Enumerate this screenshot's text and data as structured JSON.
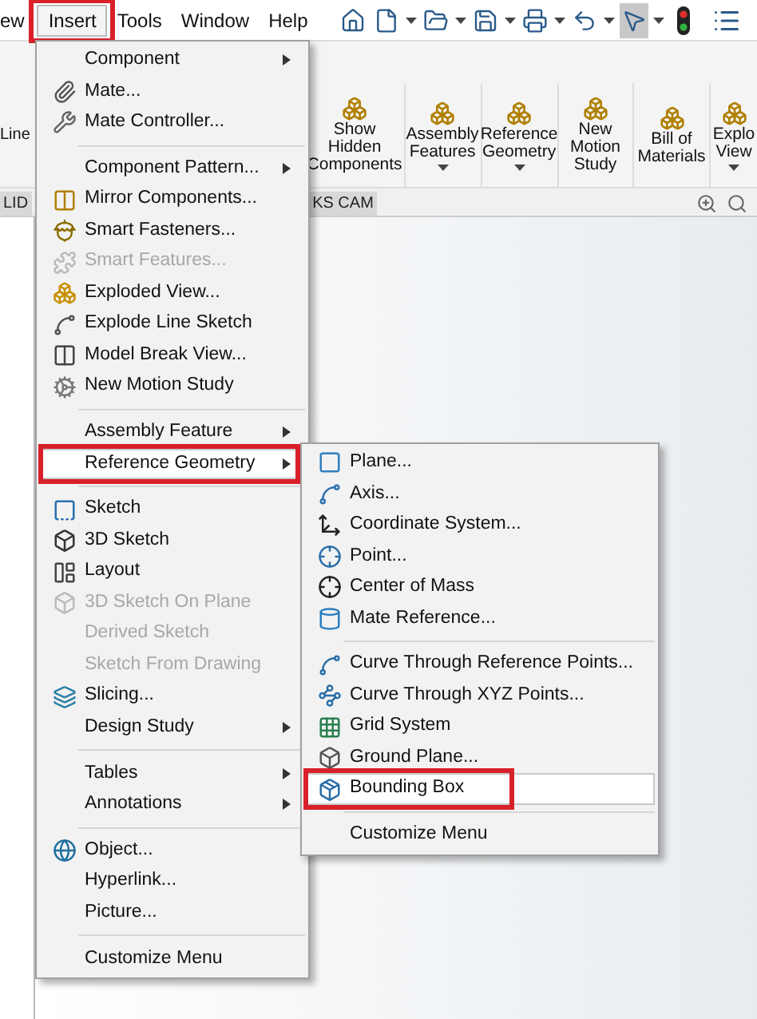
{
  "menubar": [
    {
      "label": "ew",
      "selected": false
    },
    {
      "label": "Insert",
      "selected": true
    },
    {
      "label": "Tools",
      "selected": false
    },
    {
      "label": "Window",
      "selected": false
    },
    {
      "label": "Help",
      "selected": false
    }
  ],
  "ribbon": {
    "cut_label": "Line",
    "buttons": [
      {
        "label": "Show\nHidden\nComponents",
        "dropdown": false
      },
      {
        "label": "Assembly\nFeatures",
        "dropdown": true
      },
      {
        "label": "Reference\nGeometry",
        "dropdown": true
      },
      {
        "label": "New\nMotion\nStudy",
        "dropdown": false
      },
      {
        "label": "Bill of\nMaterials",
        "dropdown": false
      },
      {
        "label": "Explo\nView",
        "dropdown": true
      }
    ]
  },
  "tabs": [
    {
      "label": "LID",
      "selected": false
    },
    {
      "label": "KS CAM",
      "selected": false
    }
  ],
  "insert_menu": [
    {
      "kind": "item",
      "label": "Component",
      "submenu": true,
      "disabled": false,
      "selected": false
    },
    {
      "kind": "item",
      "label": "Mate...",
      "submenu": false,
      "disabled": false,
      "selected": false
    },
    {
      "kind": "item",
      "label": "Mate Controller...",
      "submenu": false,
      "disabled": false,
      "selected": false
    },
    {
      "kind": "separator"
    },
    {
      "kind": "item",
      "label": "Component Pattern...",
      "submenu": true,
      "disabled": false,
      "selected": false
    },
    {
      "kind": "item",
      "label": "Mirror Components...",
      "submenu": false,
      "disabled": false,
      "selected": false
    },
    {
      "kind": "item",
      "label": "Smart Fasteners...",
      "submenu": false,
      "disabled": false,
      "selected": false
    },
    {
      "kind": "item",
      "label": "Smart Features...",
      "submenu": false,
      "disabled": true,
      "selected": false
    },
    {
      "kind": "item",
      "label": "Exploded View...",
      "submenu": false,
      "disabled": false,
      "selected": false
    },
    {
      "kind": "item",
      "label": "Explode Line Sketch",
      "submenu": false,
      "disabled": false,
      "selected": false
    },
    {
      "kind": "item",
      "label": "Model Break View...",
      "submenu": false,
      "disabled": false,
      "selected": false
    },
    {
      "kind": "item",
      "label": "New Motion Study",
      "submenu": false,
      "disabled": false,
      "selected": false
    },
    {
      "kind": "separator"
    },
    {
      "kind": "item",
      "label": "Assembly Feature",
      "submenu": true,
      "disabled": false,
      "selected": false
    },
    {
      "kind": "item",
      "label": "Reference Geometry",
      "submenu": true,
      "disabled": false,
      "selected": true
    },
    {
      "kind": "separator"
    },
    {
      "kind": "item",
      "label": "Sketch",
      "submenu": false,
      "disabled": false,
      "selected": false
    },
    {
      "kind": "item",
      "label": "3D Sketch",
      "submenu": false,
      "disabled": false,
      "selected": false
    },
    {
      "kind": "item",
      "label": "Layout",
      "submenu": false,
      "disabled": false,
      "selected": false
    },
    {
      "kind": "item",
      "label": "3D Sketch On Plane",
      "submenu": false,
      "disabled": true,
      "selected": false
    },
    {
      "kind": "item",
      "label": "Derived Sketch",
      "submenu": false,
      "disabled": true,
      "selected": false
    },
    {
      "kind": "item",
      "label": "Sketch From Drawing",
      "submenu": false,
      "disabled": true,
      "selected": false
    },
    {
      "kind": "item",
      "label": "Slicing...",
      "submenu": false,
      "disabled": false,
      "selected": false
    },
    {
      "kind": "item",
      "label": "Design Study",
      "submenu": true,
      "disabled": false,
      "selected": false
    },
    {
      "kind": "separator"
    },
    {
      "kind": "item",
      "label": "Tables",
      "submenu": true,
      "disabled": false,
      "selected": false
    },
    {
      "kind": "item",
      "label": "Annotations",
      "submenu": true,
      "disabled": false,
      "selected": false
    },
    {
      "kind": "separator"
    },
    {
      "kind": "item",
      "label": "Object...",
      "submenu": false,
      "disabled": false,
      "selected": false
    },
    {
      "kind": "item",
      "label": "Hyperlink...",
      "submenu": false,
      "disabled": false,
      "selected": false
    },
    {
      "kind": "item",
      "label": "Picture...",
      "submenu": false,
      "disabled": false,
      "selected": false
    },
    {
      "kind": "separator"
    },
    {
      "kind": "item",
      "label": "Customize Menu",
      "submenu": false,
      "disabled": false,
      "selected": false
    }
  ],
  "reference_geometry_menu": [
    {
      "kind": "item",
      "label": "Plane...",
      "selected": false
    },
    {
      "kind": "item",
      "label": "Axis...",
      "selected": false
    },
    {
      "kind": "item",
      "label": "Coordinate System...",
      "selected": false
    },
    {
      "kind": "item",
      "label": "Point...",
      "selected": false
    },
    {
      "kind": "item",
      "label": "Center of Mass",
      "selected": false
    },
    {
      "kind": "item",
      "label": "Mate Reference...",
      "selected": false
    },
    {
      "kind": "separator"
    },
    {
      "kind": "item",
      "label": "Curve Through Reference Points...",
      "selected": false
    },
    {
      "kind": "item",
      "label": "Curve Through XYZ Points...",
      "selected": false
    },
    {
      "kind": "item",
      "label": "Grid System",
      "selected": false
    },
    {
      "kind": "item",
      "label": "Ground Plane...",
      "selected": false
    },
    {
      "kind": "item",
      "label": "Bounding Box",
      "selected": true
    },
    {
      "kind": "separator"
    },
    {
      "kind": "item",
      "label": "Customize Menu",
      "selected": false
    }
  ]
}
